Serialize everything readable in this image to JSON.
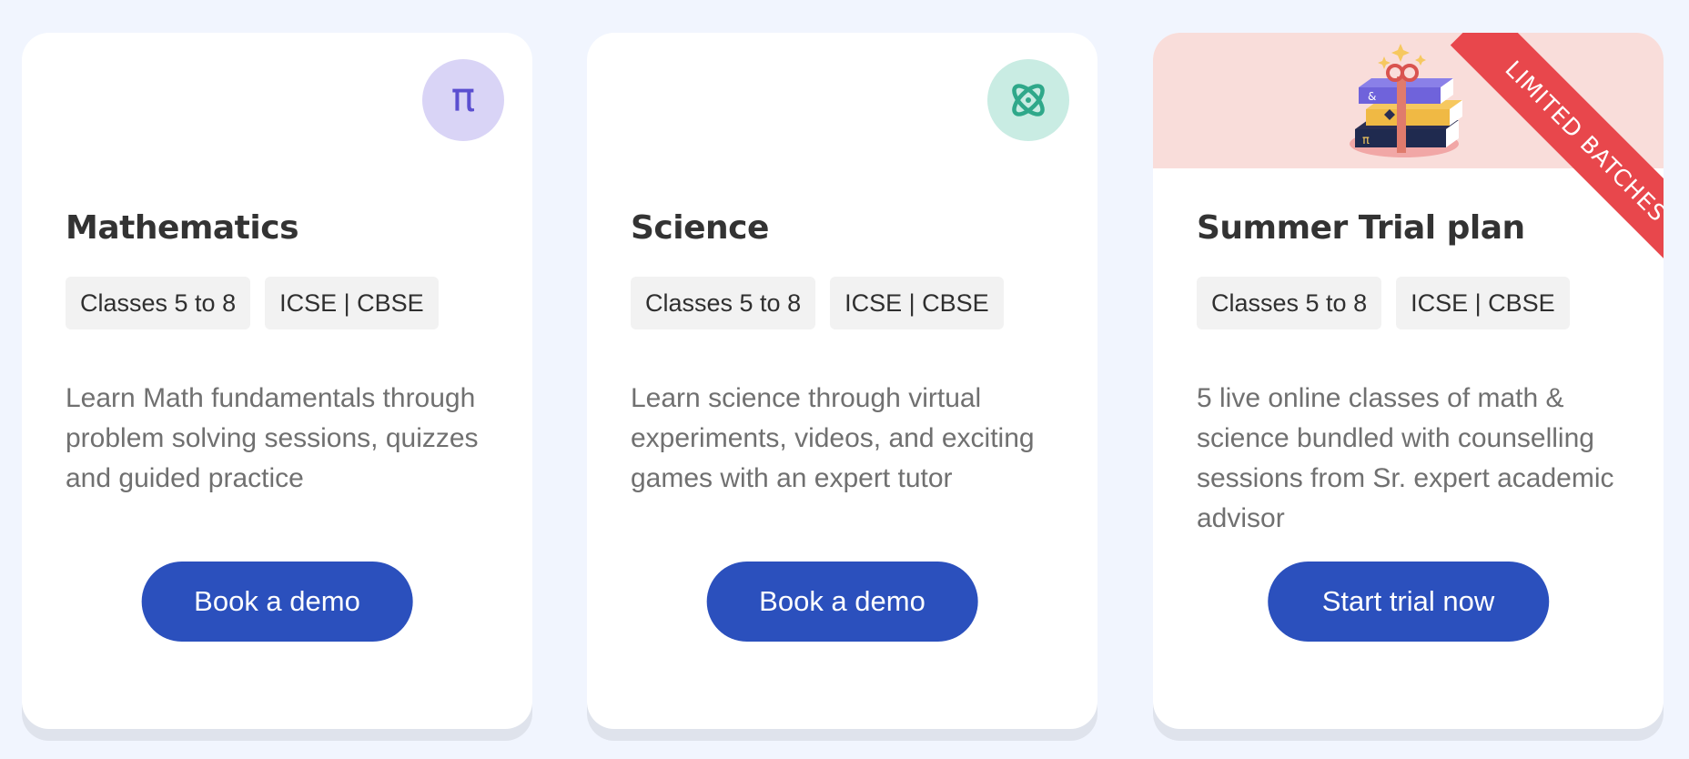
{
  "cards": [
    {
      "icon": "pi-icon",
      "icon_glyph": "π",
      "icon_color": "#5b4fd0",
      "icon_bg": "#d9d4f6",
      "title": "Mathematics",
      "tags": [
        "Classes 5 to 8",
        "ICSE | CBSE"
      ],
      "description": "Learn Math fundamentals through problem solving sessions, quizzes and guided practice",
      "button_label": "Book a demo"
    },
    {
      "icon": "atom-icon",
      "icon_color": "#2fa88a",
      "icon_bg": "#c9ece3",
      "title": "Science",
      "tags": [
        "Classes 5 to 8",
        "ICSE | CBSE"
      ],
      "description": "Learn science through virtual experiments, videos, and exciting games with an expert tutor",
      "button_label": "Book a demo"
    },
    {
      "icon": "gift-books-icon",
      "banner_bg": "#f9ddda",
      "ribbon_text": "LIMITED BATCHES",
      "ribbon_color": "#e8474c",
      "title": "Summer Trial plan",
      "tags": [
        "Classes 5 to 8",
        "ICSE | CBSE"
      ],
      "description": "5 live online classes of math & science bundled with counselling sessions from Sr. expert academic advisor",
      "button_label": "Start trial now"
    }
  ],
  "colors": {
    "page_bg": "#f1f5fe",
    "button_bg": "#2b50bd",
    "title_text": "#333333",
    "body_text": "#707070"
  }
}
